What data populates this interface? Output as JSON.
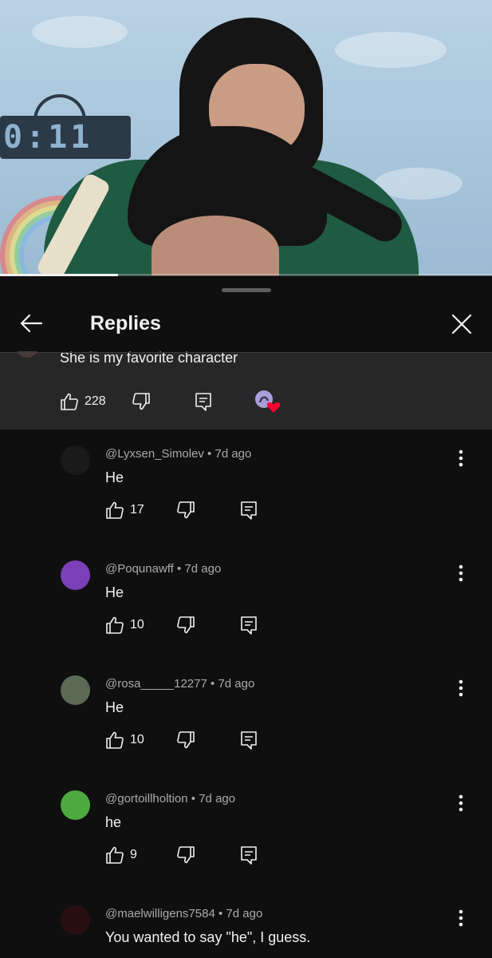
{
  "video": {
    "clock_text": "0:11",
    "progress_fraction": 0.24
  },
  "panel": {
    "title": "Replies",
    "back_icon": "arrow-left-icon",
    "close_icon": "close-icon"
  },
  "parent_comment": {
    "text": "She is my favorite character",
    "likes": "228",
    "creator_heart": true
  },
  "replies": [
    {
      "author": "@Lyxsen_Simolev",
      "time": "7d ago",
      "text": "He",
      "likes": "17",
      "avatar_color": "#1a1a1a"
    },
    {
      "author": "@Poqunawff",
      "time": "7d ago",
      "text": "He",
      "likes": "10",
      "avatar_color": "#7b3fb8"
    },
    {
      "author": "@rosa_____12277",
      "time": "7d ago",
      "text": "He",
      "likes": "10",
      "avatar_color": "#5b6a55"
    },
    {
      "author": "@gortoillholtion",
      "time": "7d ago",
      "text": "he",
      "likes": "9",
      "avatar_color": "#4caa3e"
    },
    {
      "author": "@maelwilligens7584",
      "time": "7d ago",
      "text": "You wanted to say \"he\", I guess.",
      "likes": "",
      "avatar_color": "#2a0f12"
    }
  ],
  "colors": {
    "background": "#0f0f0f",
    "parent_highlight": "#272727",
    "text_primary": "#f1f1f1",
    "text_secondary": "#aaaaaa",
    "heart": "#ff0033"
  }
}
